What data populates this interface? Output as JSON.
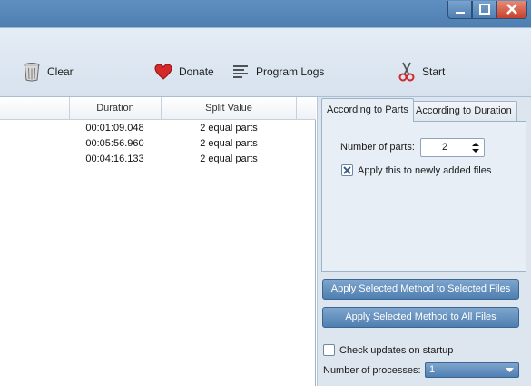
{
  "window": {
    "controls": {
      "minimize": "minimize-icon",
      "maximize": "maximize-icon",
      "close": "close-icon"
    }
  },
  "toolbar": {
    "clear_label": "Clear",
    "donate_label": "Donate",
    "logs_label": "Program Logs",
    "start_label": "Start"
  },
  "file_list": {
    "columns": [
      "Duration",
      "Split Value"
    ],
    "rows": [
      {
        "duration": "00:01:09.048",
        "split_value": "2 equal parts"
      },
      {
        "duration": "00:05:56.960",
        "split_value": "2 equal parts"
      },
      {
        "duration": "00:04:16.133",
        "split_value": "2 equal parts"
      }
    ]
  },
  "panel": {
    "tabs": [
      {
        "label": "According to Parts",
        "active": true
      },
      {
        "label": "According to Duration",
        "active": false
      }
    ],
    "parts_label": "Number of parts:",
    "parts_value": "2",
    "apply_new_label": "Apply this to newly added files",
    "apply_new_checked": true,
    "apply_selected_label": "Apply Selected Method to Selected Files",
    "apply_all_label": "Apply Selected Method to All Files",
    "check_updates_label": "Check updates on startup",
    "check_updates_checked": false,
    "processes_label": "Number of processes:",
    "processes_value": "1"
  }
}
